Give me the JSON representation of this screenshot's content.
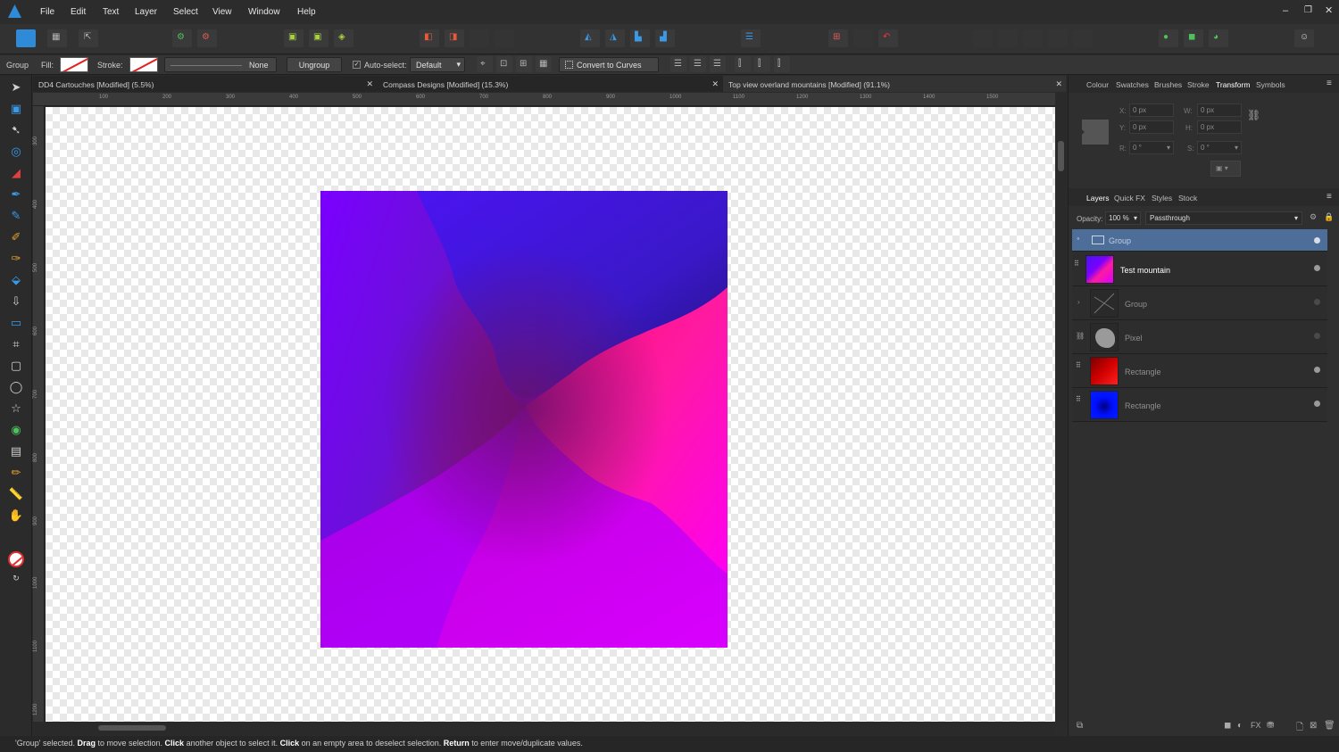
{
  "menubar": {
    "items": [
      "File",
      "Edit",
      "Text",
      "Layer",
      "Select",
      "View",
      "Window",
      "Help"
    ],
    "window_controls": [
      "minimize",
      "restore",
      "close"
    ]
  },
  "contextbar": {
    "selection_type": "Group",
    "fill_label": "Fill:",
    "stroke_label": "Stroke:",
    "stroke_style_value": "None",
    "ungroup_label": "Ungroup",
    "autoselect_label": "Auto-select:",
    "autoselect_value": "Default",
    "convert_label": "Convert to Curves"
  },
  "tabs": [
    {
      "label": "DD4 Cartouches [Modified] (5.5%)"
    },
    {
      "label": "Compass Designs [Modified] (15.3%)"
    },
    {
      "label": "Top view overland mountains [Modified] (91.1%)"
    }
  ],
  "ruler": {
    "top_ticks": [
      "100",
      "200",
      "300",
      "400",
      "500",
      "600",
      "700",
      "800",
      "900",
      "1000",
      "1100",
      "1200",
      "1300",
      "1400",
      "1500"
    ],
    "left_ticks": [
      "300",
      "400",
      "500",
      "600",
      "700",
      "800",
      "900",
      "1000",
      "1100",
      "1200"
    ]
  },
  "panels": {
    "top_tabs": [
      "Colour",
      "Swatches",
      "Brushes",
      "Stroke",
      "Transform",
      "Symbols"
    ],
    "active_top_tab": "Transform",
    "transform": {
      "x_label": "X:",
      "x_value": "0 px",
      "y_label": "Y:",
      "y_value": "0 px",
      "w_label": "W:",
      "w_value": "0 px",
      "h_label": "H:",
      "h_value": "0 px",
      "r_label": "R:",
      "r_value": "0 °",
      "s_label": "S:",
      "s_value": "0 °"
    },
    "layer_tabs": [
      "Layers",
      "Quick FX",
      "Styles",
      "Stock"
    ],
    "opacity_label": "Opacity:",
    "opacity_value": "100 %",
    "blend_mode": "Passthrough",
    "layers": [
      {
        "name": "Group",
        "selected": true
      },
      {
        "name": "Test mountain"
      },
      {
        "name": "Group"
      },
      {
        "name": "Pixel"
      },
      {
        "name": "Rectangle"
      },
      {
        "name": "Rectangle"
      }
    ]
  },
  "status": {
    "part1": "'Group' selected. ",
    "b1": "Drag",
    "part2": " to move selection. ",
    "b2": "Click",
    "part3": " another object to select it. ",
    "b3": "Click",
    "part4": " on an empty area to deselect selection. ",
    "b4": "Return",
    "part5": " to enter move/duplicate values."
  },
  "colors": {
    "accent": "#4e6e9a",
    "artwork_blue": "#4a14f0",
    "artwork_violet": "#7a00ff",
    "artwork_magenta": "#ff0aa0",
    "artwork_pink": "#ff00e0"
  }
}
